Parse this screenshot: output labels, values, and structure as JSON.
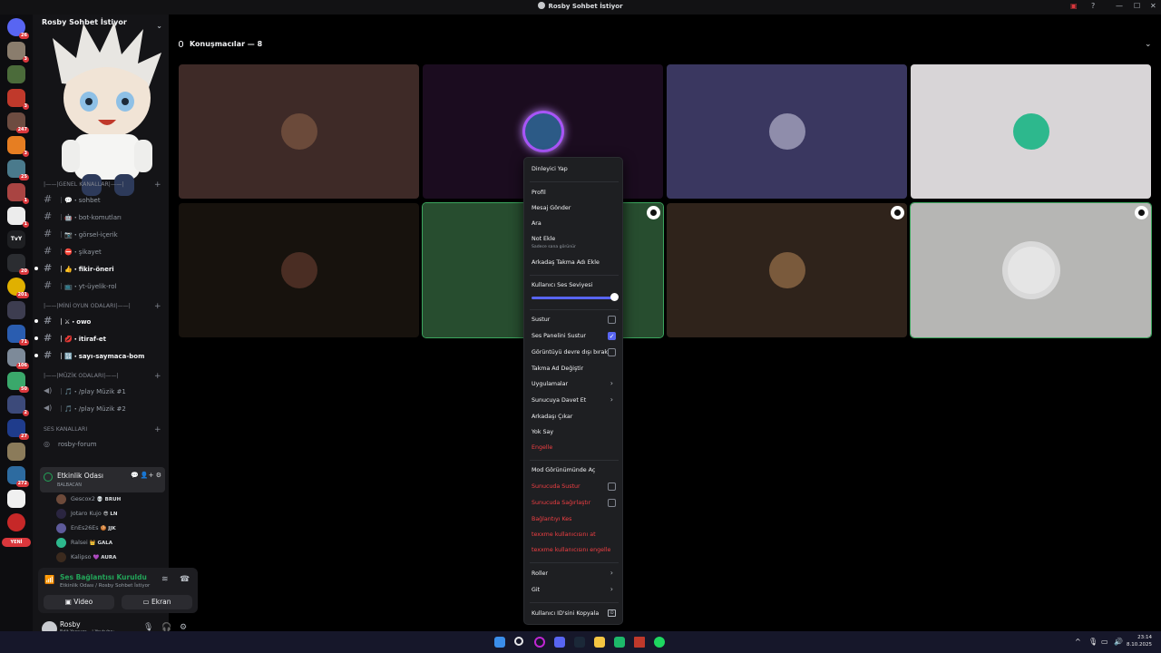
{
  "window": {
    "title": "Rosby Sohbet İstiyor",
    "controls": [
      "—",
      "☐",
      "✕"
    ]
  },
  "guilds": {
    "new_label": "YENİ",
    "badges": [
      "26",
      "3",
      "247",
      "3",
      "25",
      "1",
      "1",
      "20",
      "201",
      "71",
      "106",
      "50",
      "2",
      "27",
      "272"
    ],
    "tvy_label": "TvY"
  },
  "sidebar": {
    "server_name": "Rosby Sohbet İstiyor",
    "categories": {
      "genel": "|——|GENEL KANALLAR|——|",
      "mini_oyun": "|——|MİNİ OYUN ODALARI|——|",
      "muzik": "|——|MÜZİK ODALARI|——|",
      "ses": "SES KANALLARI"
    },
    "text_channels": [
      {
        "label": "｜💬・sohbet"
      },
      {
        "label": "｜🤖・bot-komutları"
      },
      {
        "label": "｜📷・görsel-içerik"
      },
      {
        "label": "｜⛔・şikayet"
      },
      {
        "label": "｜👍・fikir-öneri"
      },
      {
        "label": "｜📺・yt-üyelik-rol"
      },
      {
        "label": "｜⚔・owo"
      },
      {
        "label": "｜💋・itiraf-et"
      },
      {
        "label": "｜🔢・sayı-saymaca-bom"
      }
    ],
    "voice_channels": [
      {
        "label": "｜🎵・/play Müzik #1"
      },
      {
        "label": "｜🎵・/play Müzik #2"
      },
      {
        "label": "rosby-forum"
      }
    ],
    "active_voice": {
      "name": "Etkinlik Odası",
      "sub": "BALBACAN"
    },
    "members": [
      {
        "name": "Gescox2",
        "tag": "💀 BRUH"
      },
      {
        "name": "Jotaro Kujo",
        "tag": "😎 LN"
      },
      {
        "name": "EnEs26Es",
        "tag": "🍪 JJK"
      },
      {
        "name": "Ralsei",
        "tag": "👑 GALA"
      },
      {
        "name": "Kalipso",
        "tag": "💜 AURA"
      }
    ]
  },
  "voice_panel": {
    "status": "Ses Bağlantısı Kuruldu",
    "sub": "Etkinlik Odası / Rosby Sohbet İstiyor",
    "video_label": "Video",
    "screen_label": "Ekran"
  },
  "user": {
    "name": "Rosby",
    "status": "Edit Yapıyor... | Youtube:"
  },
  "stage": {
    "header": "Konuşmacılar — 8"
  },
  "tiles": [
    {
      "bg": "#3e2a27",
      "avatar": "#6b4a3a"
    },
    {
      "bg": "#1b0c1f",
      "avatar": "#2c5a86"
    },
    {
      "bg": "#3a3760",
      "avatar": "#8f8dab"
    },
    {
      "bg": "#d8d5d7",
      "avatar": "#2db88d"
    },
    {
      "bg": "#17120d",
      "avatar": "#4a2d23"
    },
    {
      "bg": "#274d2f",
      "avatar": "#3a6a45"
    },
    {
      "bg": "#2f231b",
      "avatar": "#7a5a3c"
    },
    {
      "bg": "#b6b6b4",
      "avatar": "#e5e5e5"
    }
  ],
  "context_menu": {
    "listener": "Dinleyici Yap",
    "profile": "Profil",
    "send_message": "Mesaj Gönder",
    "call": "Ara",
    "add_note": "Not Ekle",
    "note_sub": "Sadece sana görünür",
    "add_nickname": "Arkadaş Takma Adı Ekle",
    "volume_label": "Kullanıcı Ses Seviyesi",
    "volume_level": 1.0,
    "mute": "Sustur",
    "mute_soundboard": "Ses Panelini Sustur",
    "disable_video": "Görüntüyü devre dışı bırak",
    "change_nickname": "Takma Ad Değiştir",
    "apps": "Uygulamalar",
    "invite": "Sunucuya Davet Et",
    "remove_friend": "Arkadaşı Çıkar",
    "ignore": "Yok Say",
    "block": "Engelle",
    "mod_view": "Mod Görünümünde Aç",
    "server_mute": "Sunucuda Sustur",
    "server_deafen": "Sunucuda Sağırlaştır",
    "disconnect": "Bağlantıyı Kes",
    "kick": "texxme kullanıcısını at",
    "ban": "texxme kullanıcısını engelle",
    "roles": "Roller",
    "move": "Git",
    "copy_id": "Kullanıcı ID'sini Kopyala",
    "copy_id_icon": "ID"
  },
  "taskbar": {
    "time": "23:14",
    "date": "8.10.2025"
  },
  "colors": {
    "accent": "#5865f2",
    "online": "#23a559",
    "danger": "#f23f43",
    "speaking": "#3ba55d"
  }
}
